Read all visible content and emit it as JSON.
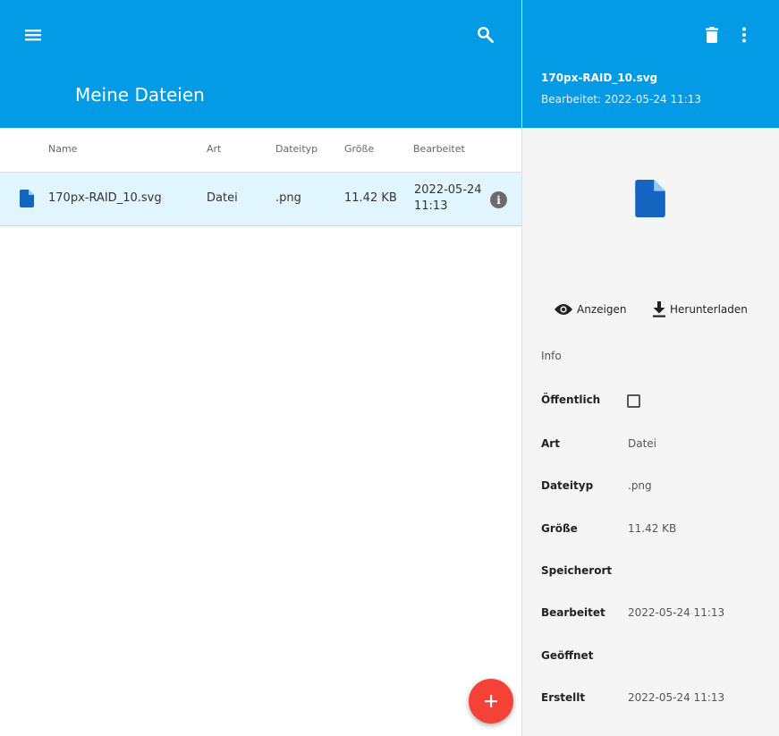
{
  "header": {
    "title": "Meine Dateien",
    "menu_icon": "menu-icon",
    "search_icon": "search-icon"
  },
  "table": {
    "columns": [
      "Name",
      "Art",
      "Dateityp",
      "Größe",
      "Bearbeitet"
    ],
    "rows": [
      {
        "icon": "file-icon",
        "name": "170px-RAID_10.svg",
        "art": "Datei",
        "dateityp": ".png",
        "groesse": "11.42 KB",
        "bearbeitet_date": "2022-05-24",
        "bearbeitet_time": "11:13",
        "info_glyph": "i"
      }
    ]
  },
  "fab": {
    "label": "+"
  },
  "details": {
    "file_name": "170px-RAID_10.svg",
    "edited_line": "Bearbeitet: 2022-05-24 11:13",
    "actions": {
      "view": "Anzeigen",
      "download": "Herunterladen"
    },
    "info_title": "Info",
    "props": {
      "public_label": "Öffentlich",
      "public_checked": false,
      "art_label": "Art",
      "art_value": "Datei",
      "type_label": "Dateityp",
      "type_value": ".png",
      "size_label": "Größe",
      "size_value": "11.42 KB",
      "location_label": "Speicherort",
      "location_value": "",
      "edited_label": "Bearbeitet",
      "edited_value": "2022-05-24 11:13",
      "opened_label": "Geöffnet",
      "opened_value": "",
      "created_label": "Erstellt",
      "created_value": "2022-05-24 11:13"
    }
  },
  "colors": {
    "primary": "#039be5",
    "selected_row": "#e1f5fe",
    "file_icon": "#1565c0",
    "fab": "#f44336",
    "panel_bg": "#f5f5f5"
  }
}
